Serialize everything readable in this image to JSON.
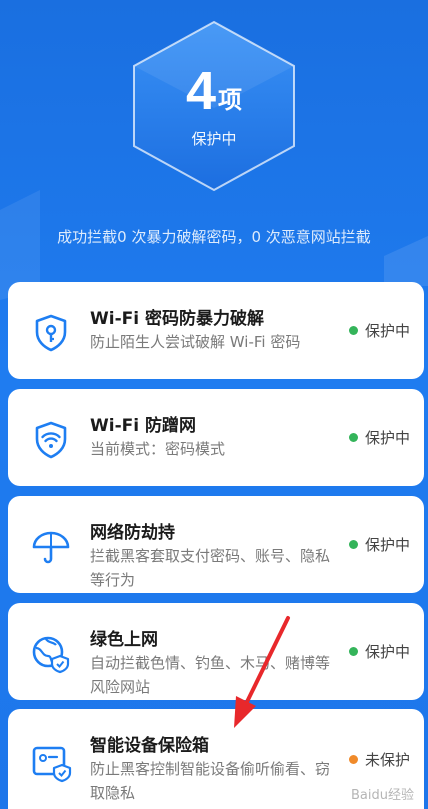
{
  "hero": {
    "count": "4",
    "unit": "项",
    "status": "保护中"
  },
  "stats_text": "成功拦截0 次暴力破解密码，0 次恶意网站拦截",
  "cards": [
    {
      "title": "Wi-Fi 密码防暴力破解",
      "desc": "防止陌生人尝试破解 Wi-Fi 密码",
      "status": "保护中",
      "status_color": "#34b45a",
      "icon": "shield-key-icon"
    },
    {
      "title": "Wi-Fi 防蹭网",
      "desc": "当前模式：密码模式",
      "status": "保护中",
      "status_color": "#34b45a",
      "icon": "wifi-shield-icon"
    },
    {
      "title": "网络防劫持",
      "desc": "拦截黑客套取支付密码、账号、隐私等行为",
      "status": "保护中",
      "status_color": "#34b45a",
      "icon": "umbrella-icon"
    },
    {
      "title": "绿色上网",
      "desc": "自动拦截色情、钓鱼、木马、赌博等风险网站",
      "status": "保护中",
      "status_color": "#34b45a",
      "icon": "globe-shield-icon"
    },
    {
      "title": "智能设备保险箱",
      "desc": "防止黑客控制智能设备偷听偷看、窃取隐私",
      "status": "未保护",
      "status_color": "#f08a2a",
      "icon": "device-shield-icon"
    }
  ],
  "watermark": "Baidu经验",
  "colors": {
    "accent": "#1f7cf0",
    "icon_blue": "#1e7ef2",
    "ok": "#34b45a",
    "warn": "#f08a2a",
    "arrow": "#e8282b"
  }
}
